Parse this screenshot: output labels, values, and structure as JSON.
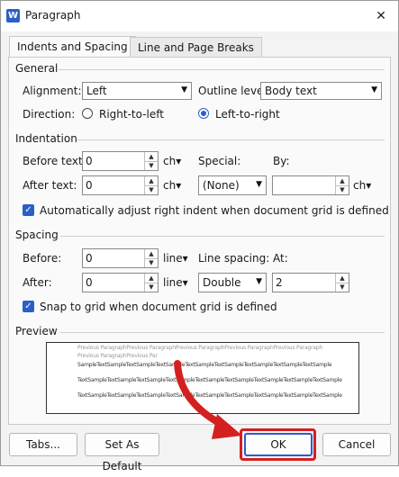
{
  "window": {
    "title": "Paragraph",
    "app_icon": "word-icon",
    "close_glyph": "✕"
  },
  "tabs": [
    {
      "label": "Indents and Spacing",
      "active": true
    },
    {
      "label": "Line and Page Breaks",
      "active": false
    }
  ],
  "general": {
    "heading": "General",
    "alignment_label": "Alignment:",
    "alignment_value": "Left",
    "outline_label": "Outline level:",
    "outline_value": "Body text",
    "direction_label": "Direction:",
    "rtl_label": "Right-to-left",
    "ltr_label": "Left-to-right",
    "direction_selected": "Left-to-right"
  },
  "indentation": {
    "heading": "Indentation",
    "before_label": "Before text:",
    "before_value": "0",
    "before_unit": "ch▾",
    "after_label": "After text:",
    "after_value": "0",
    "after_unit": "ch▾",
    "special_label": "Special:",
    "special_value": "(None)",
    "by_label": "By:",
    "by_value": "",
    "by_unit": "ch▾",
    "auto_adjust_label": "Automatically adjust right indent when document grid is defined",
    "auto_adjust_checked": true
  },
  "spacing": {
    "heading": "Spacing",
    "before_label": "Before:",
    "before_value": "0",
    "before_unit": "line▾",
    "after_label": "After:",
    "after_value": "0",
    "after_unit": "line▾",
    "line_spacing_label": "Line spacing:",
    "line_spacing_value": "Double",
    "at_label": "At:",
    "at_value": "2",
    "snap_label": "Snap to grid when document grid is defined",
    "snap_checked": true
  },
  "preview": {
    "heading": "Preview",
    "prev_line1": "Previous ParagraphPrevious ParagraphPrevious ParagraphPrevious ParagraphPrevious Paragraph",
    "prev_line2": "Previous ParagraphPrevious Par",
    "sample_line1": "SampleTextSampleTextSampleTextSampleTextSampleTextSampleTextSampleTextSampleTextSample",
    "sample_line2": "TextSampleTextSampleTextSampleTextSampleTextSampleTextSampleTextSampleTextSampleTextSample",
    "sample_line3": "TextSampleTextSampleTextSampleTextSampleTextSampleTextSampleTextSampleTextSampleTextSample"
  },
  "buttons": {
    "tabs": "Tabs...",
    "set_default": "Set As Default",
    "ok": "OK",
    "cancel": "Cancel"
  },
  "colors": {
    "accent": "#2b5fc8",
    "highlight": "#d42020"
  }
}
